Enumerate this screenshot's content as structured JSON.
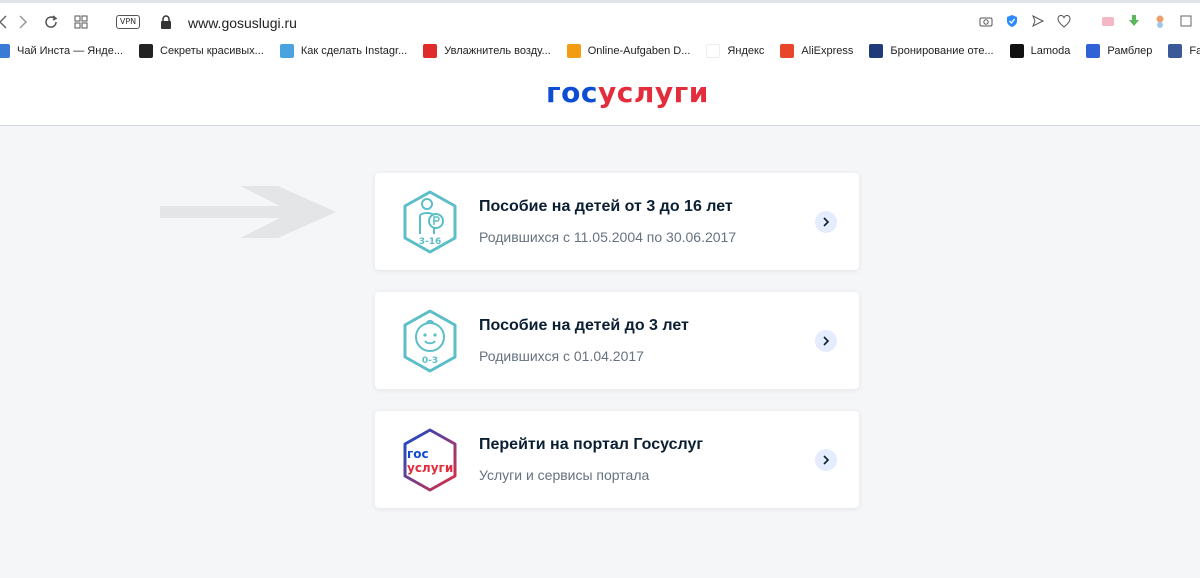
{
  "browser": {
    "vpn_label": "VPN",
    "url": "www.gosuslugi.ru",
    "bookmarks": [
      {
        "label": "Чай Инста — Яндe...",
        "color": "#3a7bd5"
      },
      {
        "label": "Секреты красивых...",
        "color": "#222222"
      },
      {
        "label": "Как сделать Instagr...",
        "color": "#4aa3df"
      },
      {
        "label": "Увлажнитель возду...",
        "color": "#e02b2b"
      },
      {
        "label": "Online-Aufgaben D...",
        "color": "#f39c12"
      },
      {
        "label": "Яндекс",
        "color": "#ffffff"
      },
      {
        "label": "AliExpress",
        "color": "#e8462a"
      },
      {
        "label": "Бронирование оте...",
        "color": "#1f3b78"
      },
      {
        "label": "Lamoda",
        "color": "#111111"
      },
      {
        "label": "Рамблер",
        "color": "#3061d6"
      },
      {
        "label": "Faceboo",
        "color": "#3b5998"
      }
    ]
  },
  "site": {
    "logo_part1": "гос",
    "logo_part2": "услуги",
    "brand_blue": "#0d4cd3",
    "brand_red": "#e42d3c",
    "icon_teal": "#5bbec8"
  },
  "cards": [
    {
      "title": "Пособие на детей от 3 до 16 лет",
      "subtitle": "Родившихся с 11.05.2004 по 30.06.2017",
      "icon_text": "3-16",
      "icon": "child-ruble-icon"
    },
    {
      "title": "Пособие на детей до 3 лет",
      "subtitle": "Родившихся с 01.04.2017",
      "icon_text": "0-3",
      "icon": "baby-face-icon"
    },
    {
      "title": "Перейти на портал Госуслуг",
      "subtitle": "Услуги и сервисы портала",
      "icon_text_1": "гос",
      "icon_text_2": "услуги",
      "icon": "gosuslugi-logo-icon"
    }
  ]
}
